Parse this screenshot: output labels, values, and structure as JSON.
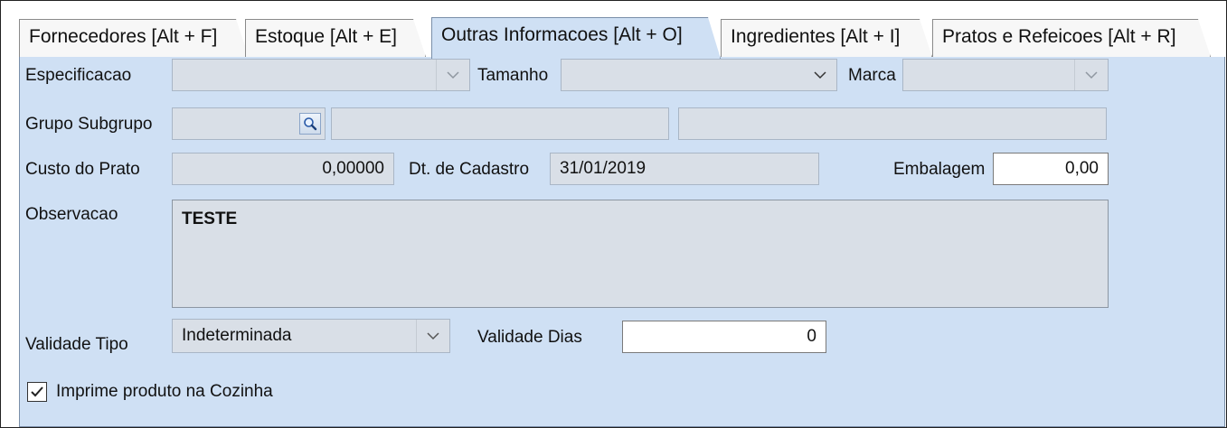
{
  "tabs": [
    {
      "label": "Fornecedores [Alt + F]"
    },
    {
      "label": "Estoque [Alt + E]"
    },
    {
      "label": "Outras Informacoes [Alt + O]"
    },
    {
      "label": "Ingredientes [Alt + I]"
    },
    {
      "label": "Pratos e Refeicoes [Alt + R]"
    }
  ],
  "active_tab": "Outras Informacoes [Alt + O]",
  "form": {
    "especificacao_label": "Especificacao",
    "especificacao_value": "",
    "tamanho_label": "Tamanho",
    "tamanho_value": "",
    "marca_label": "Marca",
    "marca_value": "",
    "grupo_label": "Grupo Subgrupo",
    "grupo_value": "",
    "custo_label": "Custo do Prato",
    "custo_value": "0,00000",
    "dt_cadastro_label": "Dt. de Cadastro",
    "dt_cadastro_value": "31/01/2019",
    "embalagem_label": "Embalagem",
    "embalagem_value": "0,00",
    "observacao_label": "Observacao",
    "observacao_value": "TESTE",
    "validade_tipo_label": "Validade Tipo",
    "validade_tipo_value": "Indeterminada",
    "validade_dias_label": "Validade Dias",
    "validade_dias_value": "0",
    "imprime_label": "Imprime produto na Cozinha",
    "imprime_checked": true
  },
  "colors": {
    "panel": "#cfe0f4",
    "disabled_field": "#d9dfe7"
  }
}
